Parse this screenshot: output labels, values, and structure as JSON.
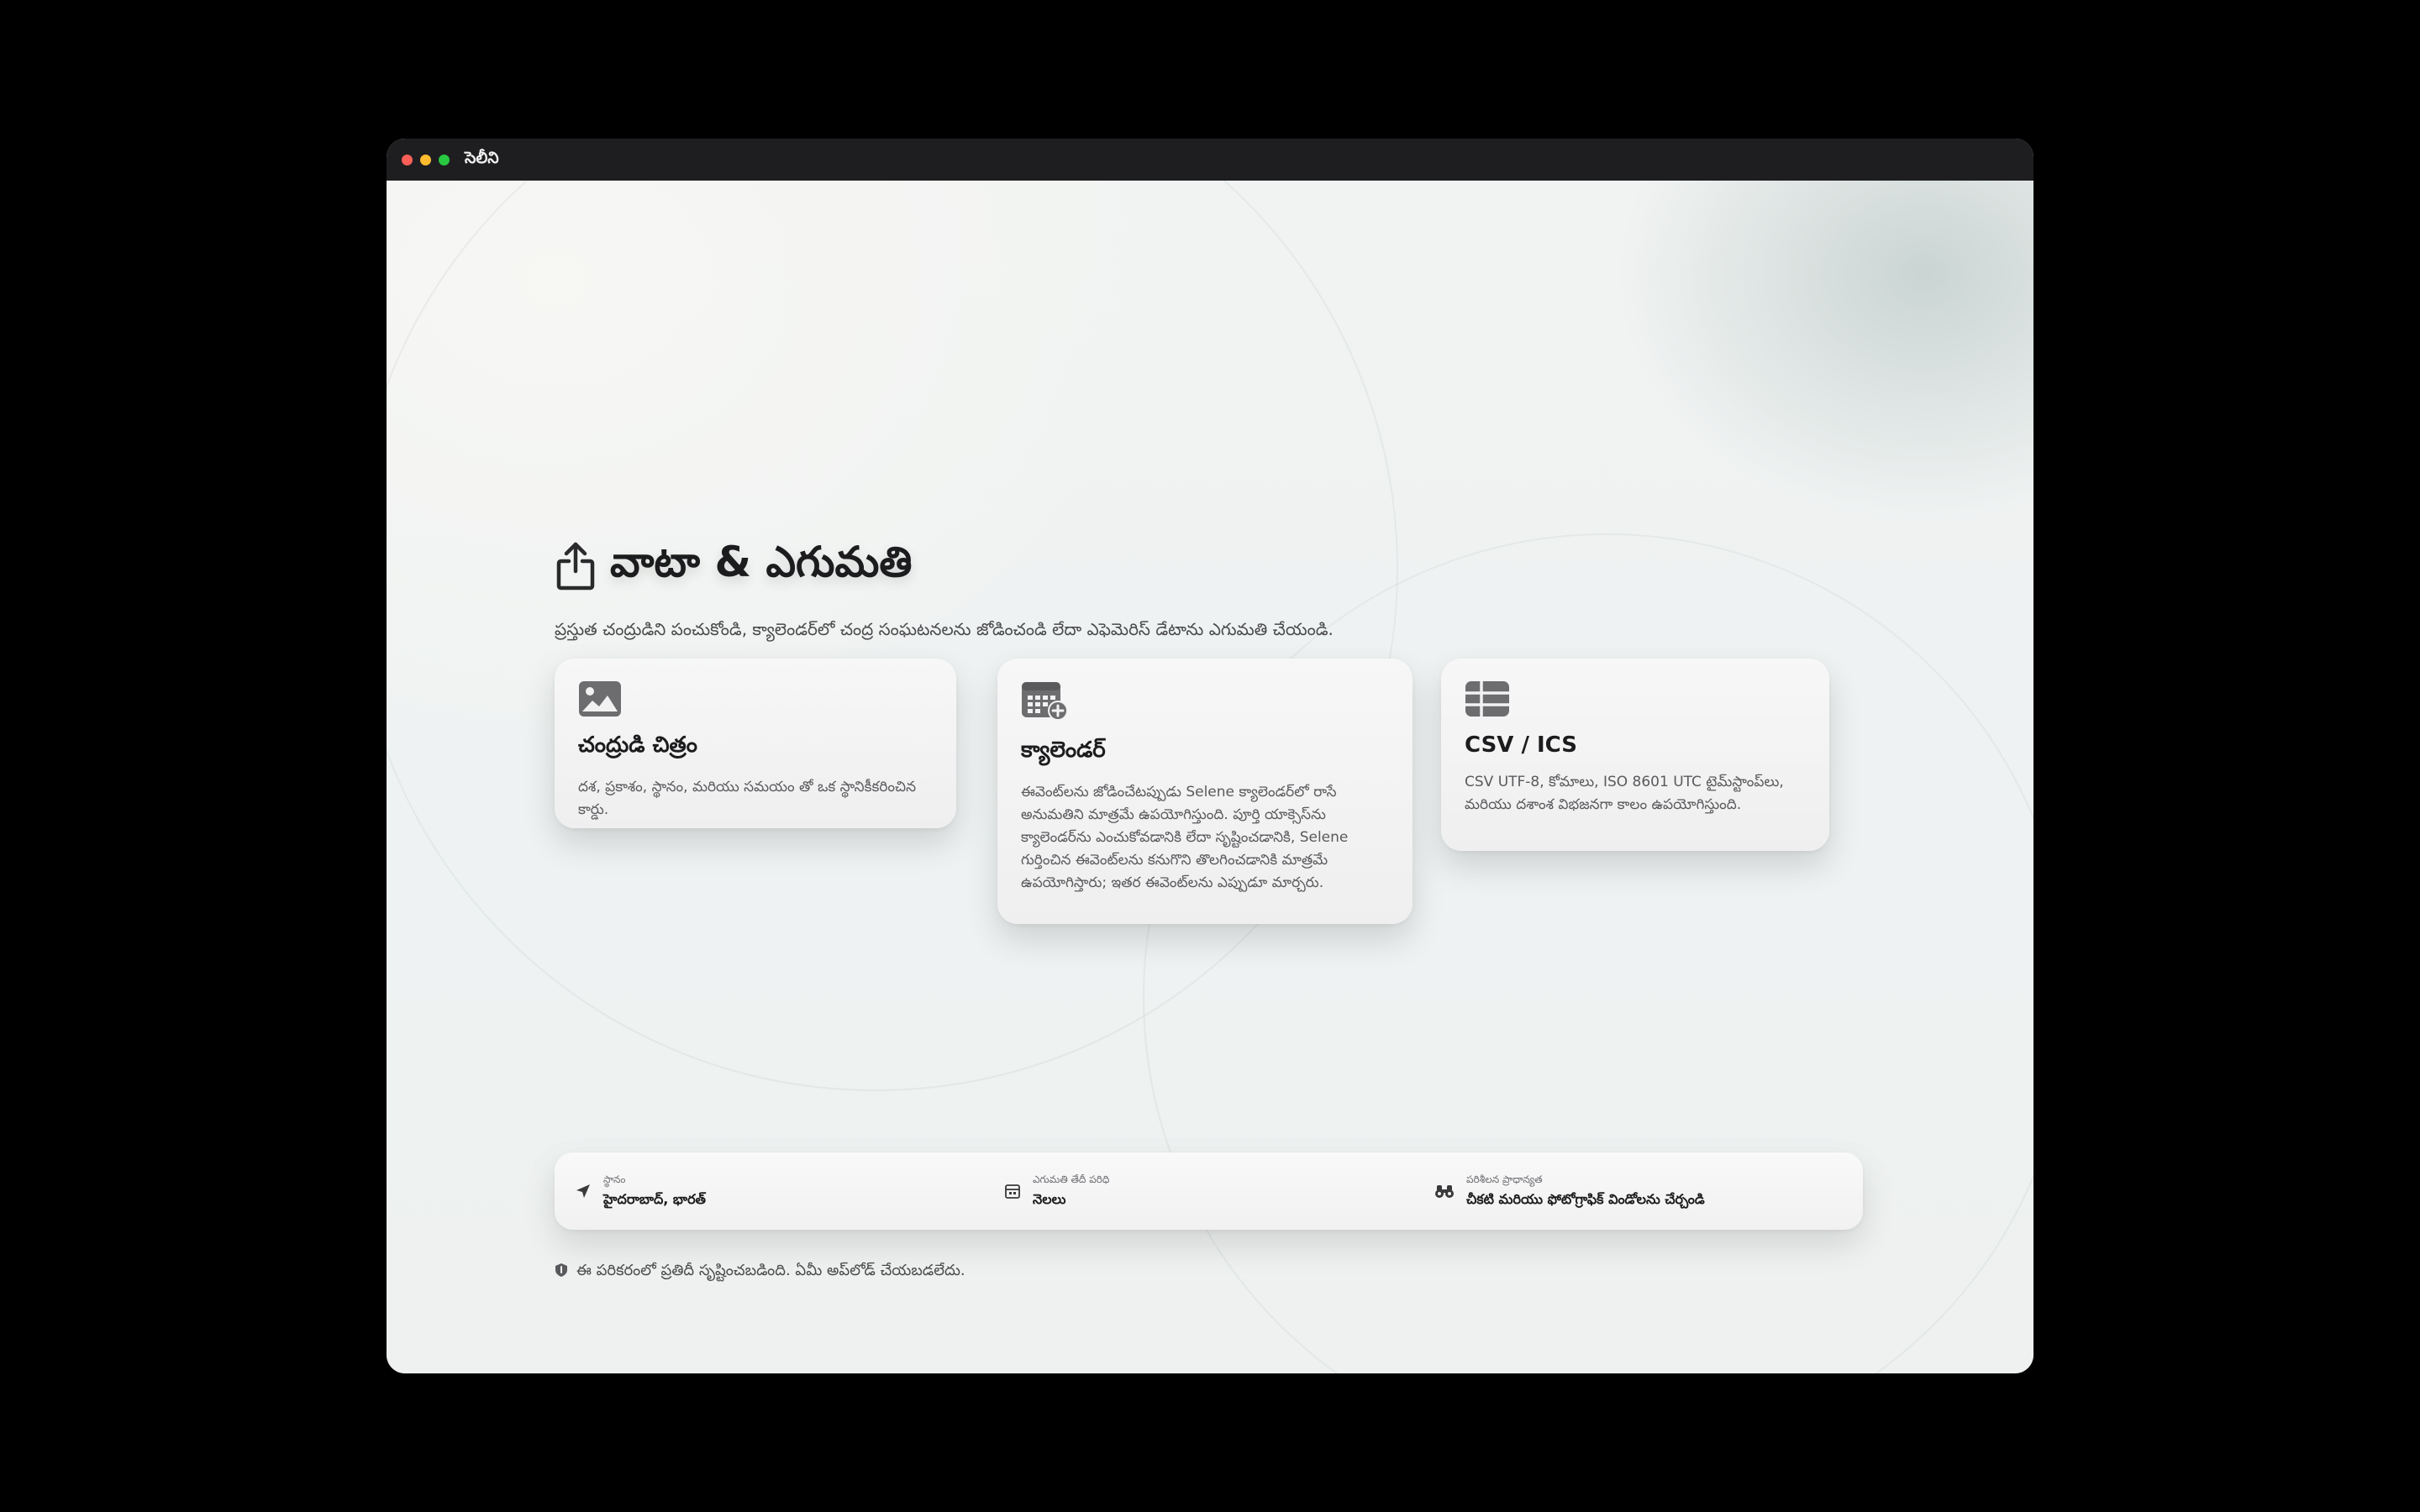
{
  "window": {
    "title": "సెలీని"
  },
  "page": {
    "title": "వాటా & ఎగుమతి",
    "subtitle": "ప్రస్తుత చంద్రుడిని పంచుకోండి, క్యాలెండర్‌లో చంద్ర సంఘటనలను జోడించండి లేదా ఎఫెమెరిస్ డేటాను ఎగుమతి చేయండి."
  },
  "cards": [
    {
      "icon": "image-icon",
      "title": "చంద్రుడి చిత్రం",
      "description": "దశ, ప్రకాశం, స్థానం, మరియు సమయం తో ఒక స్థానికీకరించిన కార్డు."
    },
    {
      "icon": "calendar-add-icon",
      "title": "క్యాలెండర్",
      "description": "ఈవెంట్‌లను జోడించేటప్పుడు Selene క్యాలెండర్‌లో రాసే అనుమతిని మాత్రమే ఉపయోగిస్తుంది. పూర్తి యాక్సెస్‌ను క్యాలెండర్‌ను ఎంచుకోవడానికి లేదా సృష్టించడానికి, Selene గుర్తించిన ఈవెంట్‌లను కనుగొని తొలగించడానికి మాత్రమే ఉపయోగిస్తారు; ఇతర ఈవెంట్‌లను ఎప్పుడూ మార్చరు."
    },
    {
      "icon": "table-icon",
      "title": "CSV / ICS",
      "description": "CSV UTF-8, కోమాలు, ISO 8601 UTC టైమ్‌స్టాంప్‌లు, మరియు దశాంశ విభజనగా కాలం ఉపయోగిస్తుంది."
    }
  ],
  "info": {
    "location": {
      "icon": "location-arrow-icon",
      "label": "స్థానం",
      "value": "హైదరాబాద్, భారత్"
    },
    "export_range": {
      "icon": "calendar-icon",
      "label": "ఎగుమతి తేదీ పరిధి",
      "value": "నెలలు"
    },
    "observing_preference": {
      "icon": "binoculars-icon",
      "label": "పరిశీలన ప్రాధాన్యత",
      "value": "చీకటి మరియు ఫోటోగ్రాఫిక్ విండోలను చేర్చండి"
    }
  },
  "footer": {
    "icon": "shield-icon",
    "privacy_note": "ఈ పరికరంలో ప్రతిదీ సృష్టించబడింది. ఏమీ అప్‌లోడ్ చేయబడలేదు."
  },
  "colors": {
    "traffic_red": "#ff5f57",
    "traffic_yellow": "#febc2e",
    "traffic_green": "#28c840",
    "titlebar": "#1e1e20",
    "icon_gray": "#6d6d70"
  }
}
